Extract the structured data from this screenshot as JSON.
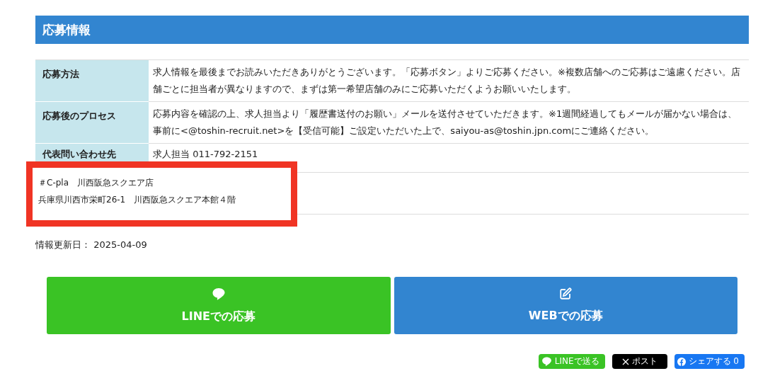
{
  "section_title": "応募情報",
  "rows": [
    {
      "label": "応募方法",
      "value": "求人情報を最後までお読みいただきありがとうございます。「応募ボタン」よりご応募ください。※複数店舗へのご応募はご遠慮ください。店舗ごとに担当者が異なりますので、まずは第一希望店舗のみにご応募いただくようお願いいたします。"
    },
    {
      "label": "応募後のプロセス",
      "value": "応募内容を確認の上、求人担当より「履歴書送付のお願い」メールを送付させていただきます。※1週間経過してもメールが届かない場合は、事前に<@toshin-recruit.net>を【受信可能】ご設定いただいた上で、saiyou-as@toshin.jpn.comにご連絡ください。"
    },
    {
      "label": "代表問い合わせ先",
      "value": "求人担当 011-792-2151"
    },
    {}
  ],
  "callout": {
    "lines": [
      "＃C-pla　川西阪急スクエア店",
      "兵庫県川西市栄町26-1　川西阪急スクエア本館４階"
    ]
  },
  "updated": "情報更新日： 2025-04-09",
  "apply_buttons": [
    {
      "kind": "line",
      "label": "LINEでの応募"
    },
    {
      "kind": "web",
      "label": "WEBでの応募"
    }
  ],
  "share_buttons": [
    {
      "kind": "line",
      "label": "LINEで送る"
    },
    {
      "kind": "x",
      "label": "ポスト"
    },
    {
      "kind": "facebook",
      "label": "シェアする 0"
    }
  ]
}
